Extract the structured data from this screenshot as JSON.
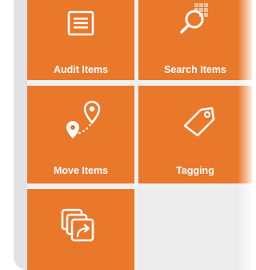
{
  "tiles": [
    {
      "label": "Audit Items",
      "icon": "list-icon"
    },
    {
      "label": "Search Items",
      "icon": "search-icon"
    },
    {
      "label": "Move Items",
      "icon": "location-pin-icon"
    },
    {
      "label": "Tagging",
      "icon": "tag-icon"
    },
    {
      "label": "",
      "icon": "copy-share-icon"
    }
  ],
  "colors": {
    "tile": "#e9782b",
    "icon": "#ffffff",
    "background": "#f0f0f0"
  }
}
